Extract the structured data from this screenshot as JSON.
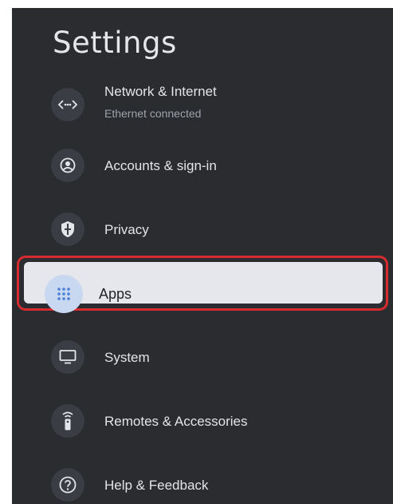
{
  "screen": {
    "title": "Settings"
  },
  "items": [
    {
      "label": "Network & Internet",
      "sublabel": "Ethernet connected",
      "icon": "network-arrows-icon"
    },
    {
      "label": "Accounts & sign-in",
      "icon": "account-circle-icon"
    },
    {
      "label": "Privacy",
      "icon": "privacy-shield-icon"
    },
    {
      "label": "Apps",
      "icon": "apps-grid-icon",
      "focused": true
    },
    {
      "label": "System",
      "icon": "monitor-icon"
    },
    {
      "label": "Remotes & Accessories",
      "icon": "remote-icon"
    },
    {
      "label": "Help & Feedback",
      "icon": "help-icon"
    }
  ],
  "colors": {
    "background": "#2a2c30",
    "focus_card": "#e5e7ec",
    "focus_outline": "#d62b2f",
    "focus_icon_bg": "#c9d8f1",
    "focus_icon_dots": "#4a7dd6"
  }
}
